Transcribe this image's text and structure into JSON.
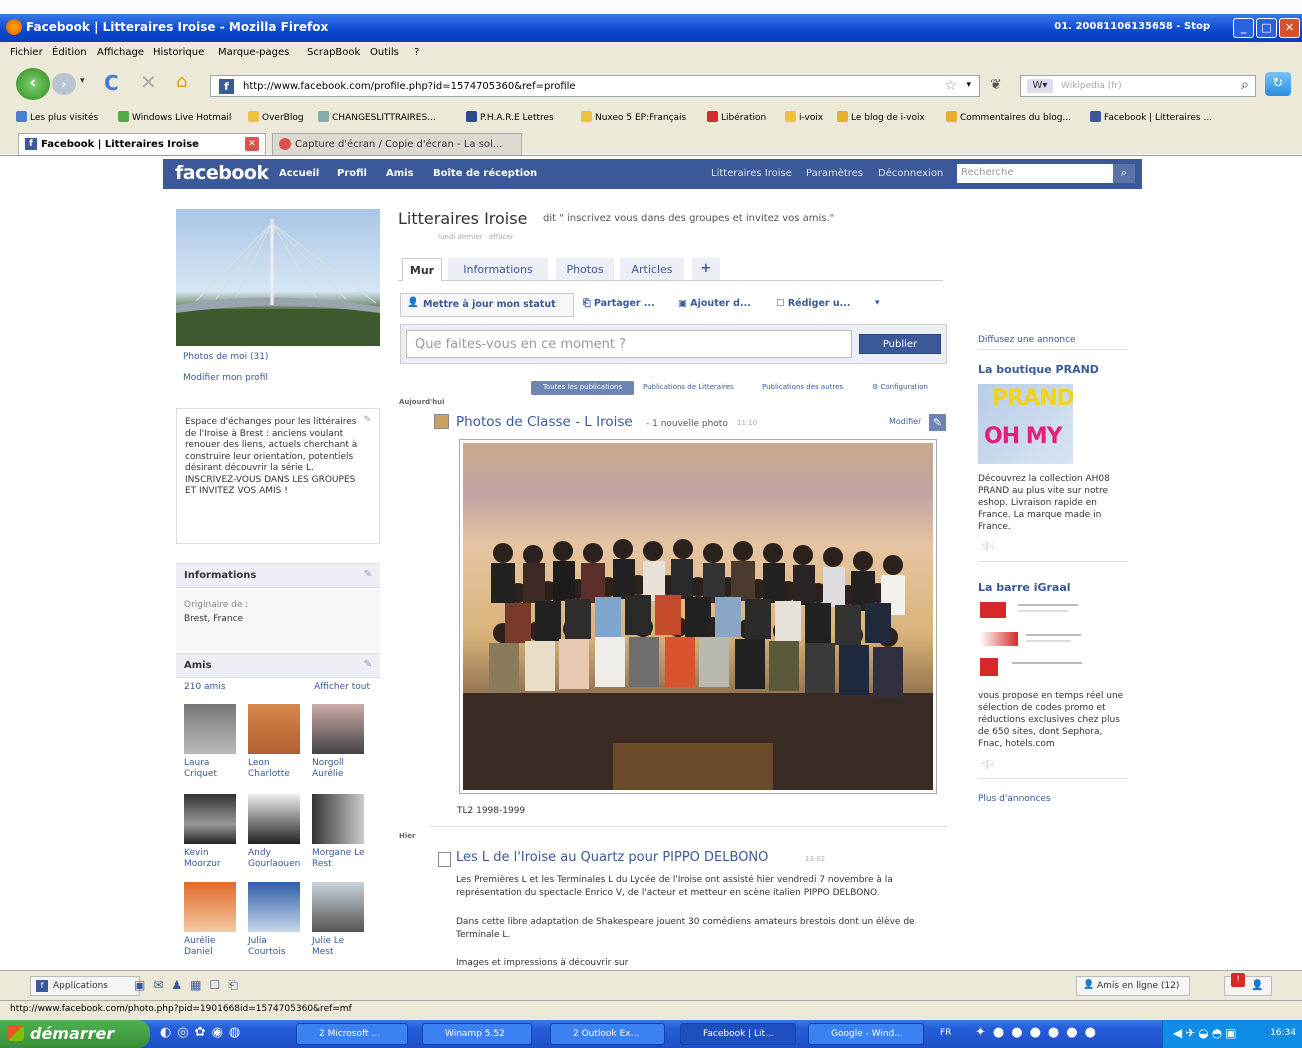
{
  "window": {
    "title": "Facebook | Litteraires Iroise - Mozilla Firefox",
    "right_text": "01. 20081106135658 - Stop"
  },
  "menu": [
    "Fichier",
    "Édition",
    "Affichage",
    "Historique",
    "Marque-pages",
    "ScrapBook",
    "Outils",
    "?"
  ],
  "nav": {
    "url": "http://www.facebook.com/profile.php?id=1574705360&ref=profile",
    "search_placeholder": "Wikipedia (fr)"
  },
  "bookmarks": [
    "Les plus visités",
    "Windows Live Hotmail",
    "OverBlog",
    "CHANGESLITTRAIRES...",
    "P.H.A.R.E Lettres",
    "Nuxeo 5 EP:Français",
    "Libération",
    "i-voix",
    "Le blog de i-voix",
    "Commentaires du blog...",
    "Facebook | Litteraires ..."
  ],
  "tabs": [
    {
      "label": "Facebook | Litteraires Iroise"
    },
    {
      "label": "Capture d'écran / Copie d'écran - La sol..."
    }
  ],
  "fb": {
    "logo": "facebook",
    "nav_left": [
      "Accueil",
      "Profil",
      "Amis",
      "Boîte de réception"
    ],
    "nav_right": [
      "Litteraires Iroise",
      "Paramètres",
      "Déconnexion"
    ],
    "search_placeholder": "Recherche",
    "left": {
      "photos_link": "Photos de moi (31)",
      "edit_profile": "Modifier mon profil",
      "about": "Espace d'échanges pour les littéraires de l'Iroise à Brest : anciens voulant renouer des liens, actuels cherchant à construire leur orientation, potentiels désirant découvrir la série L. INSCRIVEZ-VOUS DANS LES GROUPES ET INVITEZ VOS AMIS !",
      "info_title": "Informations",
      "origin_label": "Originaire de :",
      "origin_value": "Brest, France",
      "friends_title": "Amis",
      "friends_count": "210 amis",
      "friends_all": "Afficher tout",
      "friends": [
        {
          "first": "Laura",
          "last": "Criquet"
        },
        {
          "first": "Leon",
          "last": "Charlotte"
        },
        {
          "first": "Norgoll",
          "last": "Aurélie"
        },
        {
          "first": "Kevin",
          "last": "Moorzur"
        },
        {
          "first": "Andy",
          "last": "Gourlaouen"
        },
        {
          "first": "Morgane Le",
          "last": "Rest"
        },
        {
          "first": "Aurélie",
          "last": "Daniel"
        },
        {
          "first": "Julia",
          "last": "Courtois"
        },
        {
          "first": "Julie Le",
          "last": "Mest"
        }
      ]
    },
    "profile": {
      "name": "Litteraires Iroise",
      "status": "dit \" inscrivez vous dans des groupes et invitez vos amis.\"",
      "status_meta": "lundi dernier · effacer",
      "tabs": [
        "Mur",
        "Informations",
        "Photos",
        "Articles",
        "+"
      ],
      "actions": [
        "Mettre à jour mon statut",
        "Partager ...",
        "Ajouter d...",
        "Rédiger u..."
      ],
      "composer_placeholder": "Que faites-vous en ce moment ?",
      "publish": "Publier",
      "filters": [
        "Toutes les publications",
        "Publications de Litteraires",
        "Publications des autres",
        "Configuration"
      ],
      "today": "Aujourd'hui",
      "post1_title": "Photos de Classe - L Iroise",
      "post1_meta": " - 1 nouvelle photo",
      "post1_time": "11:10",
      "post1_edit": "Modifier",
      "caption": "TL2 1998-1999",
      "yesterday": "Hier",
      "post2_title": "Les L de l'Iroise au Quartz pour PIPPO DELBONO",
      "post2_time": "13:02",
      "post2_p1": "Les Premières L et les Terminales L du Lycée de l'Iroise ont assisté hier vendredi 7 novembre à la représentation du spectacle Enrico V, de l'acteur et metteur en scène italien PIPPO DELBONO.",
      "post2_p2": "Dans cette libre adaptation de Shakespeare jouent 30 comédiens amateurs brestois dont un élève de Terminale L.",
      "post2_p3": "Images et impressions à découvrir sur"
    },
    "right": {
      "ad_header": "Diffusez une annonce",
      "ad1_title": "La boutique PRAND",
      "ad1_img_text": "PRAND",
      "ad1_img_text2": "OH MY",
      "ad1_text": "Découvrez la collection AH08 PRAND au plus vite sur notre eshop. Livraison rapide en France. La marque made in France.",
      "ad2_title": "La barre iGraal",
      "ad2_text": "vous propose en temps réel une sélection de codes promo et réductions exclusives chez plus de 650 sites, dont Sephora, Fnac, hotels.com",
      "more_ads": "Plus d'annonces"
    },
    "bottom": {
      "applications": "Applications",
      "online": "Amis en ligne (12)"
    }
  },
  "statusbar": "http://www.facebook.com/photo.php?pid=1901668id=1574705360&ref=mf",
  "taskbar": {
    "start": "démarrer",
    "tasks": [
      "2 Microsoft ...",
      "Winamp 5.52",
      "2 Outlook Ex...",
      "Facebook | Lit...",
      "Google - Wind..."
    ],
    "lang": "FR",
    "time": "16:34"
  }
}
